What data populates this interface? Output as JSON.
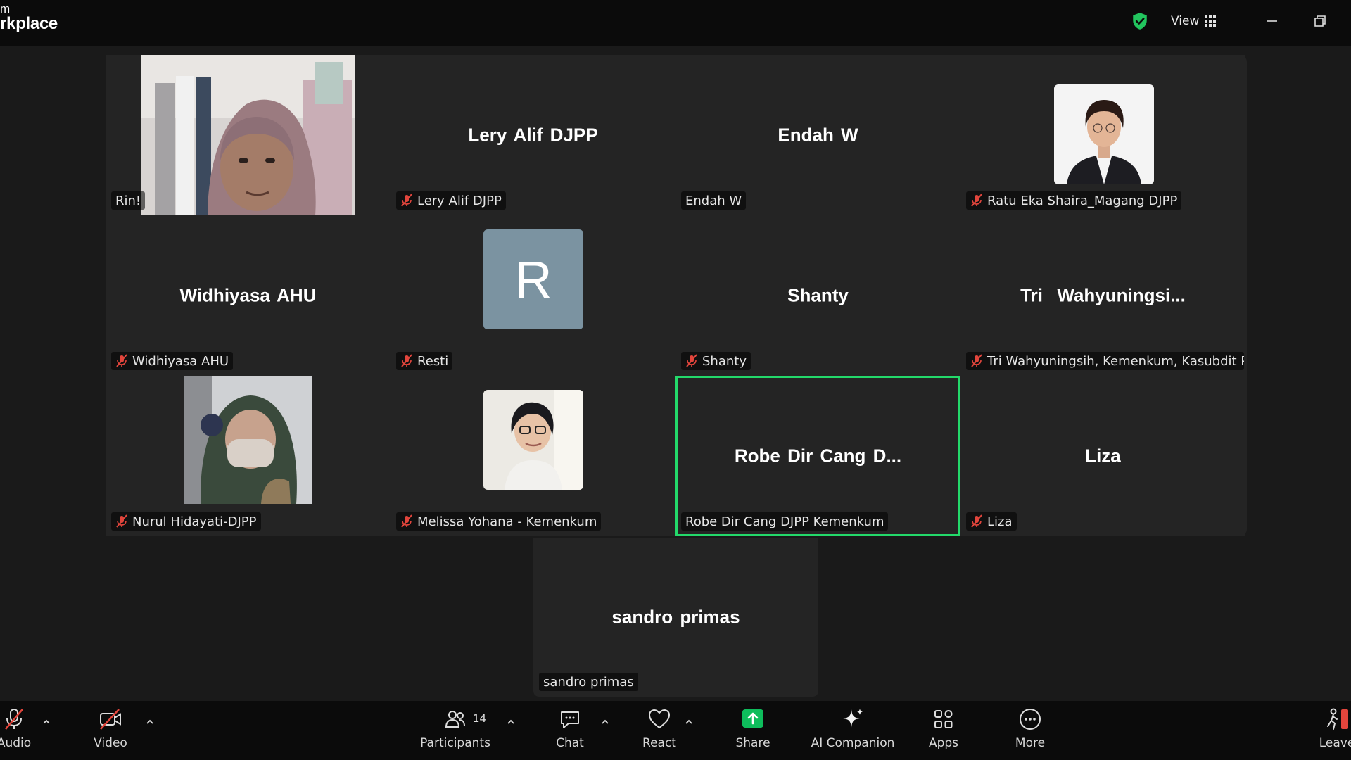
{
  "window": {
    "title_line1": "m",
    "title_line2": "rkplace",
    "view_label": "View"
  },
  "colors": {
    "active_speaker": "#23d96a",
    "mute_red": "#e2453c",
    "share_green": "#0ebd5c",
    "shield_green": "#22c55e",
    "avatar_r_bg": "#7b93a1"
  },
  "participants": [
    {
      "display": "",
      "label": "Rin!",
      "muted": false,
      "media": "video"
    },
    {
      "display": "Lery Alif DJPP",
      "label": "Lery Alif DJPP",
      "muted": true,
      "media": "name"
    },
    {
      "display": "Endah W",
      "label": "Endah W",
      "muted": false,
      "media": "name"
    },
    {
      "display": "",
      "label": "Ratu Eka Shaira_Magang DJPP",
      "muted": true,
      "media": "photo"
    },
    {
      "display": "Widhiyasa AHU",
      "label": "Widhiyasa AHU",
      "muted": true,
      "media": "name"
    },
    {
      "display": "R",
      "label": "Resti",
      "muted": true,
      "media": "initial"
    },
    {
      "display": "Shanty",
      "label": "Shanty",
      "muted": true,
      "media": "name"
    },
    {
      "display": "Tri  Wahyuningsi...",
      "label": "Tri Wahyuningsih, Kemenkum, Kasubdit P...",
      "muted": true,
      "media": "name"
    },
    {
      "display": "",
      "label": "Nurul Hidayati-DJPP",
      "muted": true,
      "media": "photo"
    },
    {
      "display": "",
      "label": "Melissa Yohana - Kemenkum",
      "muted": true,
      "media": "photo"
    },
    {
      "display": "Robe Dir Cang D...",
      "label": "Robe Dir Cang DJPP Kemenkum",
      "muted": false,
      "media": "name",
      "active": true
    },
    {
      "display": "Liza",
      "label": "Liza",
      "muted": true,
      "media": "name"
    },
    {
      "display": "sandro primas",
      "label": "sandro primas",
      "muted": false,
      "media": "name"
    }
  ],
  "toolbar": {
    "audio": "Audio",
    "video": "Video",
    "participants": "Participants",
    "participants_count": "14",
    "chat": "Chat",
    "react": "React",
    "share": "Share",
    "ai_companion": "AI Companion",
    "apps": "Apps",
    "more": "More",
    "leave": "Leave"
  }
}
